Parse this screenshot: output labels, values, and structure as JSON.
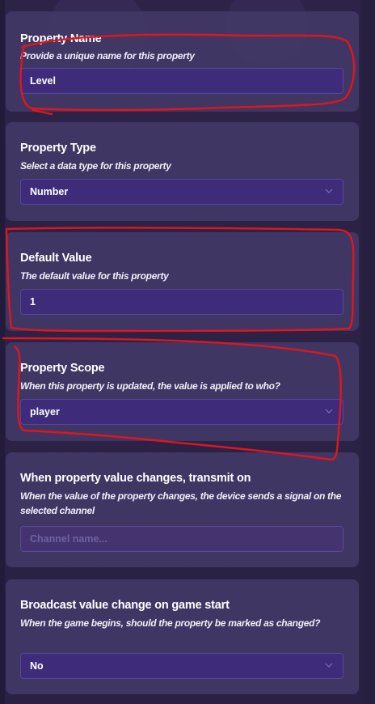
{
  "sections": [
    {
      "title": "Property Name",
      "description": "Provide a unique name for this property",
      "field_value": "Level"
    },
    {
      "title": "Property Type",
      "description": "Select a data type for this property",
      "field_value": "Number"
    },
    {
      "title": "Default Value",
      "description": "The default value for this property",
      "field_value": "1"
    },
    {
      "title": "Property Scope",
      "description": "When this property is updated, the value is applied to who?",
      "field_value": "player"
    },
    {
      "title": "When property value changes, transmit on",
      "description": "When the value of the property changes, the device sends a signal on the selected channel",
      "field_placeholder": "Channel name..."
    },
    {
      "title": "Broadcast value change on game start",
      "description": "When the game begins, should the property be marked as changed?",
      "field_value": "No"
    }
  ],
  "colors": {
    "background": "#2a2144",
    "card": "#423866",
    "field": "#3e2c7a",
    "annotation": "#e0161c"
  },
  "icons": {
    "dropdown": "chevron-down-icon"
  }
}
